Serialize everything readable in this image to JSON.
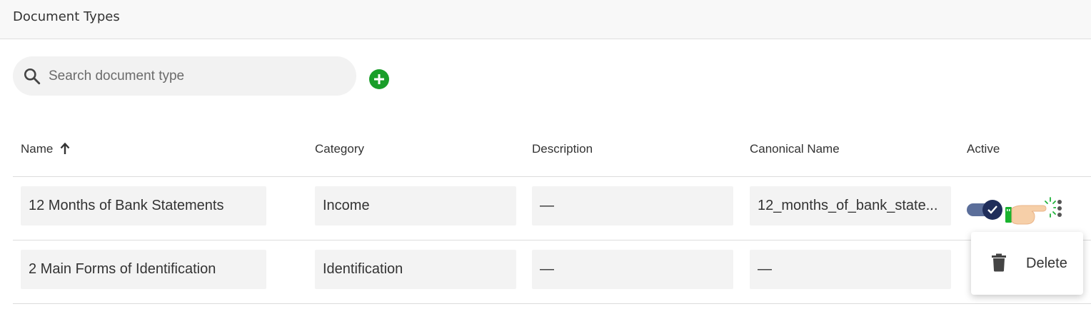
{
  "header": {
    "title": "Document Types"
  },
  "search": {
    "placeholder": "Search document type",
    "value": ""
  },
  "table": {
    "columns": [
      "Name",
      "Category",
      "Description",
      "Canonical Name",
      "Active"
    ],
    "rows": [
      {
        "name": "12 Months of Bank Statements",
        "category": "Income",
        "description": "—",
        "canonical_name": "12_months_of_bank_state...",
        "active": true
      },
      {
        "name": "2 Main Forms of Identification",
        "category": "Identification",
        "description": "—",
        "canonical_name": "—",
        "active": null
      }
    ]
  },
  "context_menu": {
    "delete_label": "Delete"
  },
  "icons": {
    "search": "search-icon",
    "add": "plus-circle-icon",
    "sort": "arrow-up-icon",
    "more": "more-vertical-icon",
    "delete": "trash-icon",
    "pointer": "hand-pointer-icon"
  },
  "colors": {
    "add_button": "#1a9e2a",
    "toggle_track": "#5b6e9a",
    "toggle_knob": "#1f2d5a"
  }
}
